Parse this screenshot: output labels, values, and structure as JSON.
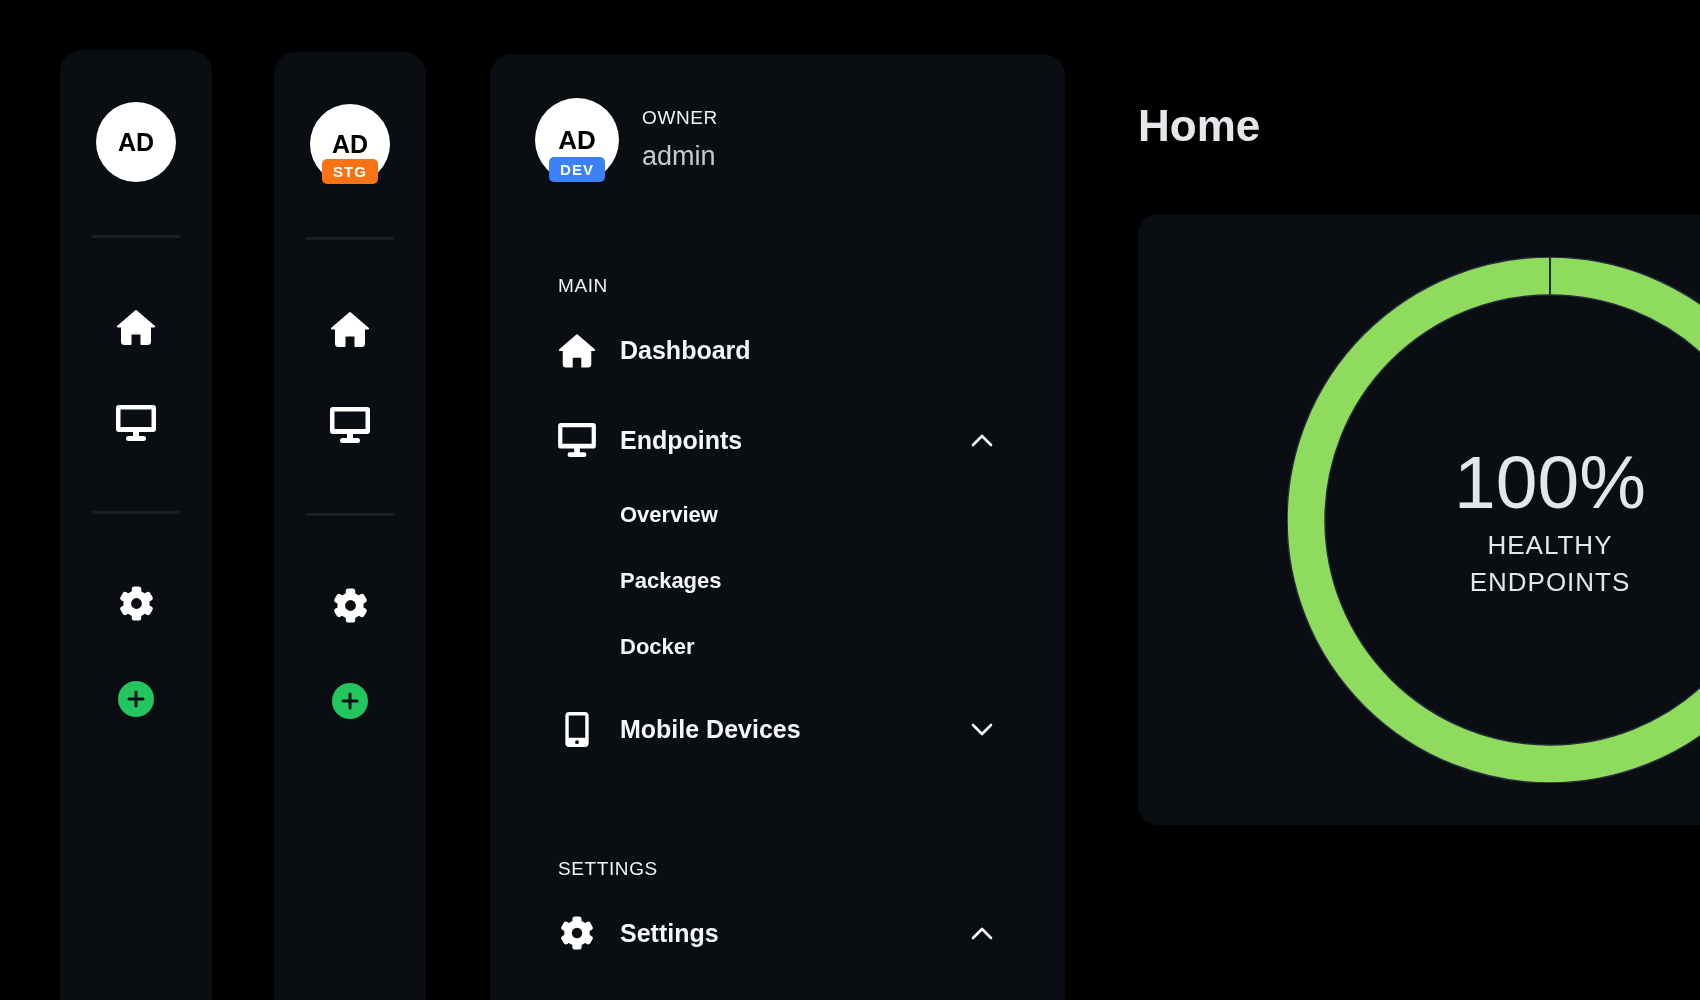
{
  "rails": [
    {
      "avatar": {
        "initials": "AD"
      }
    },
    {
      "avatar": {
        "initials": "AD",
        "badge": {
          "label": "STG",
          "color": "#f97316"
        }
      }
    }
  ],
  "sidebar": {
    "avatar": {
      "initials": "AD",
      "badge": {
        "label": "DEV",
        "color": "#3b82f6"
      }
    },
    "role": "OWNER",
    "username": "admin",
    "sections": [
      {
        "title": "MAIN",
        "items": [
          {
            "kind": "link",
            "label": "Dashboard"
          },
          {
            "kind": "group",
            "label": "Endpoints",
            "expanded": true,
            "children": [
              {
                "label": "Overview"
              },
              {
                "label": "Packages"
              },
              {
                "label": "Docker"
              }
            ]
          },
          {
            "kind": "group",
            "label": "Mobile Devices",
            "expanded": false
          }
        ]
      },
      {
        "title": "SETTINGS",
        "items": [
          {
            "kind": "group",
            "label": "Settings",
            "expanded": true
          }
        ]
      }
    ]
  },
  "page": {
    "title": "Home"
  },
  "health_card": {
    "level": 1,
    "value": "100%",
    "caption": "HEALTHY ENDPOINTS"
  }
}
